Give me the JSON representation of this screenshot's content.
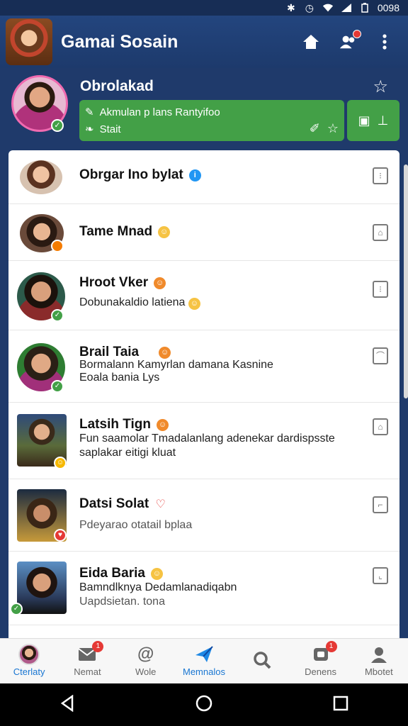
{
  "status_bar": {
    "time": "0098"
  },
  "app": {
    "title": "Gamai Sosain"
  },
  "profile": {
    "name": "Obrolakad",
    "status_line1": "Akmulan p lans Rantyifoo",
    "status_line2": "Stait"
  },
  "chats": [
    {
      "name": "Obrgar Ino bylat",
      "msg": "",
      "emoji": "blue"
    },
    {
      "name": "Tame Mnad",
      "msg": "",
      "emoji": "yellow"
    },
    {
      "name": "Hroot Vker",
      "msg": "Dobunakaldio latiena",
      "emoji": "orange"
    },
    {
      "name": "Brail Taia",
      "msg": "Bormalann Kamyrlan damana Kasnine",
      "msg2": "Eoala bania Lys",
      "emoji": "orange"
    },
    {
      "name": "Latsih Tign",
      "msg": "Fun saamolar Tmadalanlang adenekar dardispsste",
      "msg2": "saplakar eitigi kluat",
      "emoji": "orange"
    },
    {
      "name": "Datsi Solat",
      "msg": "Pdeyarao otatail bplaa",
      "emoji": "red"
    },
    {
      "name": "Eida Baria",
      "msg": "Bamndlknya Dedamlanadiqabn",
      "msg2": "Uapdsietan. tona",
      "emoji": "yellow"
    }
  ],
  "bottom_nav": [
    {
      "label": "Cterlaty",
      "icon": "avatar-icon",
      "active": false
    },
    {
      "label": "Nemat",
      "icon": "mail-icon",
      "badge": "1"
    },
    {
      "label": "Wole",
      "icon": "at-icon"
    },
    {
      "label": "Memnalos",
      "icon": "paper-plane-icon",
      "active": true
    },
    {
      "label": "",
      "icon": "search-icon"
    },
    {
      "label": "Denens",
      "icon": "chat-icon",
      "badge": "1"
    },
    {
      "label": "Mbotet",
      "icon": "person-icon"
    }
  ],
  "colors": {
    "app_bar": "#23457e",
    "accent_green": "#43a047",
    "active_tab": "#1976d2"
  }
}
